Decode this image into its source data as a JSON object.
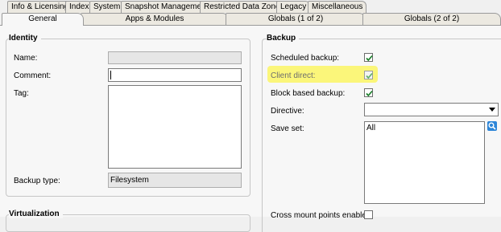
{
  "top_tabs": [
    {
      "label": "Info & Licensing"
    },
    {
      "label": "Index"
    },
    {
      "label": "System"
    },
    {
      "label": "Snapshot Management"
    },
    {
      "label": "Restricted Data Zones"
    },
    {
      "label": "Legacy"
    },
    {
      "label": "Miscellaneous"
    }
  ],
  "sub_tabs": [
    {
      "label": "General",
      "active": true
    },
    {
      "label": "Apps & Modules",
      "active": false
    },
    {
      "label": "Globals (1 of 2)",
      "active": false
    },
    {
      "label": "Globals (2 of 2)",
      "active": false
    }
  ],
  "identity": {
    "title": "Identity",
    "name_label": "Name:",
    "name_value": "",
    "comment_label": "Comment:",
    "comment_value": "",
    "tag_label": "Tag:",
    "tag_value": "",
    "backup_type_label": "Backup type:",
    "backup_type_value": "Filesystem"
  },
  "virtualization": {
    "title": "Virtualization"
  },
  "backup": {
    "title": "Backup",
    "scheduled_backup_label": "Scheduled backup:",
    "scheduled_backup_checked": true,
    "client_direct_label": "Client direct:",
    "client_direct_checked": true,
    "block_based_label": "Block based backup:",
    "block_based_checked": true,
    "directive_label": "Directive:",
    "directive_value": "",
    "save_set_label": "Save set:",
    "save_set_value": "All",
    "cross_mount_label": "Cross mount points enabled:",
    "cross_mount_checked": false
  },
  "colors": {
    "highlight": "#fbf67a",
    "check_green": "#1a7f2a",
    "search_blue": "#2d86d8"
  }
}
